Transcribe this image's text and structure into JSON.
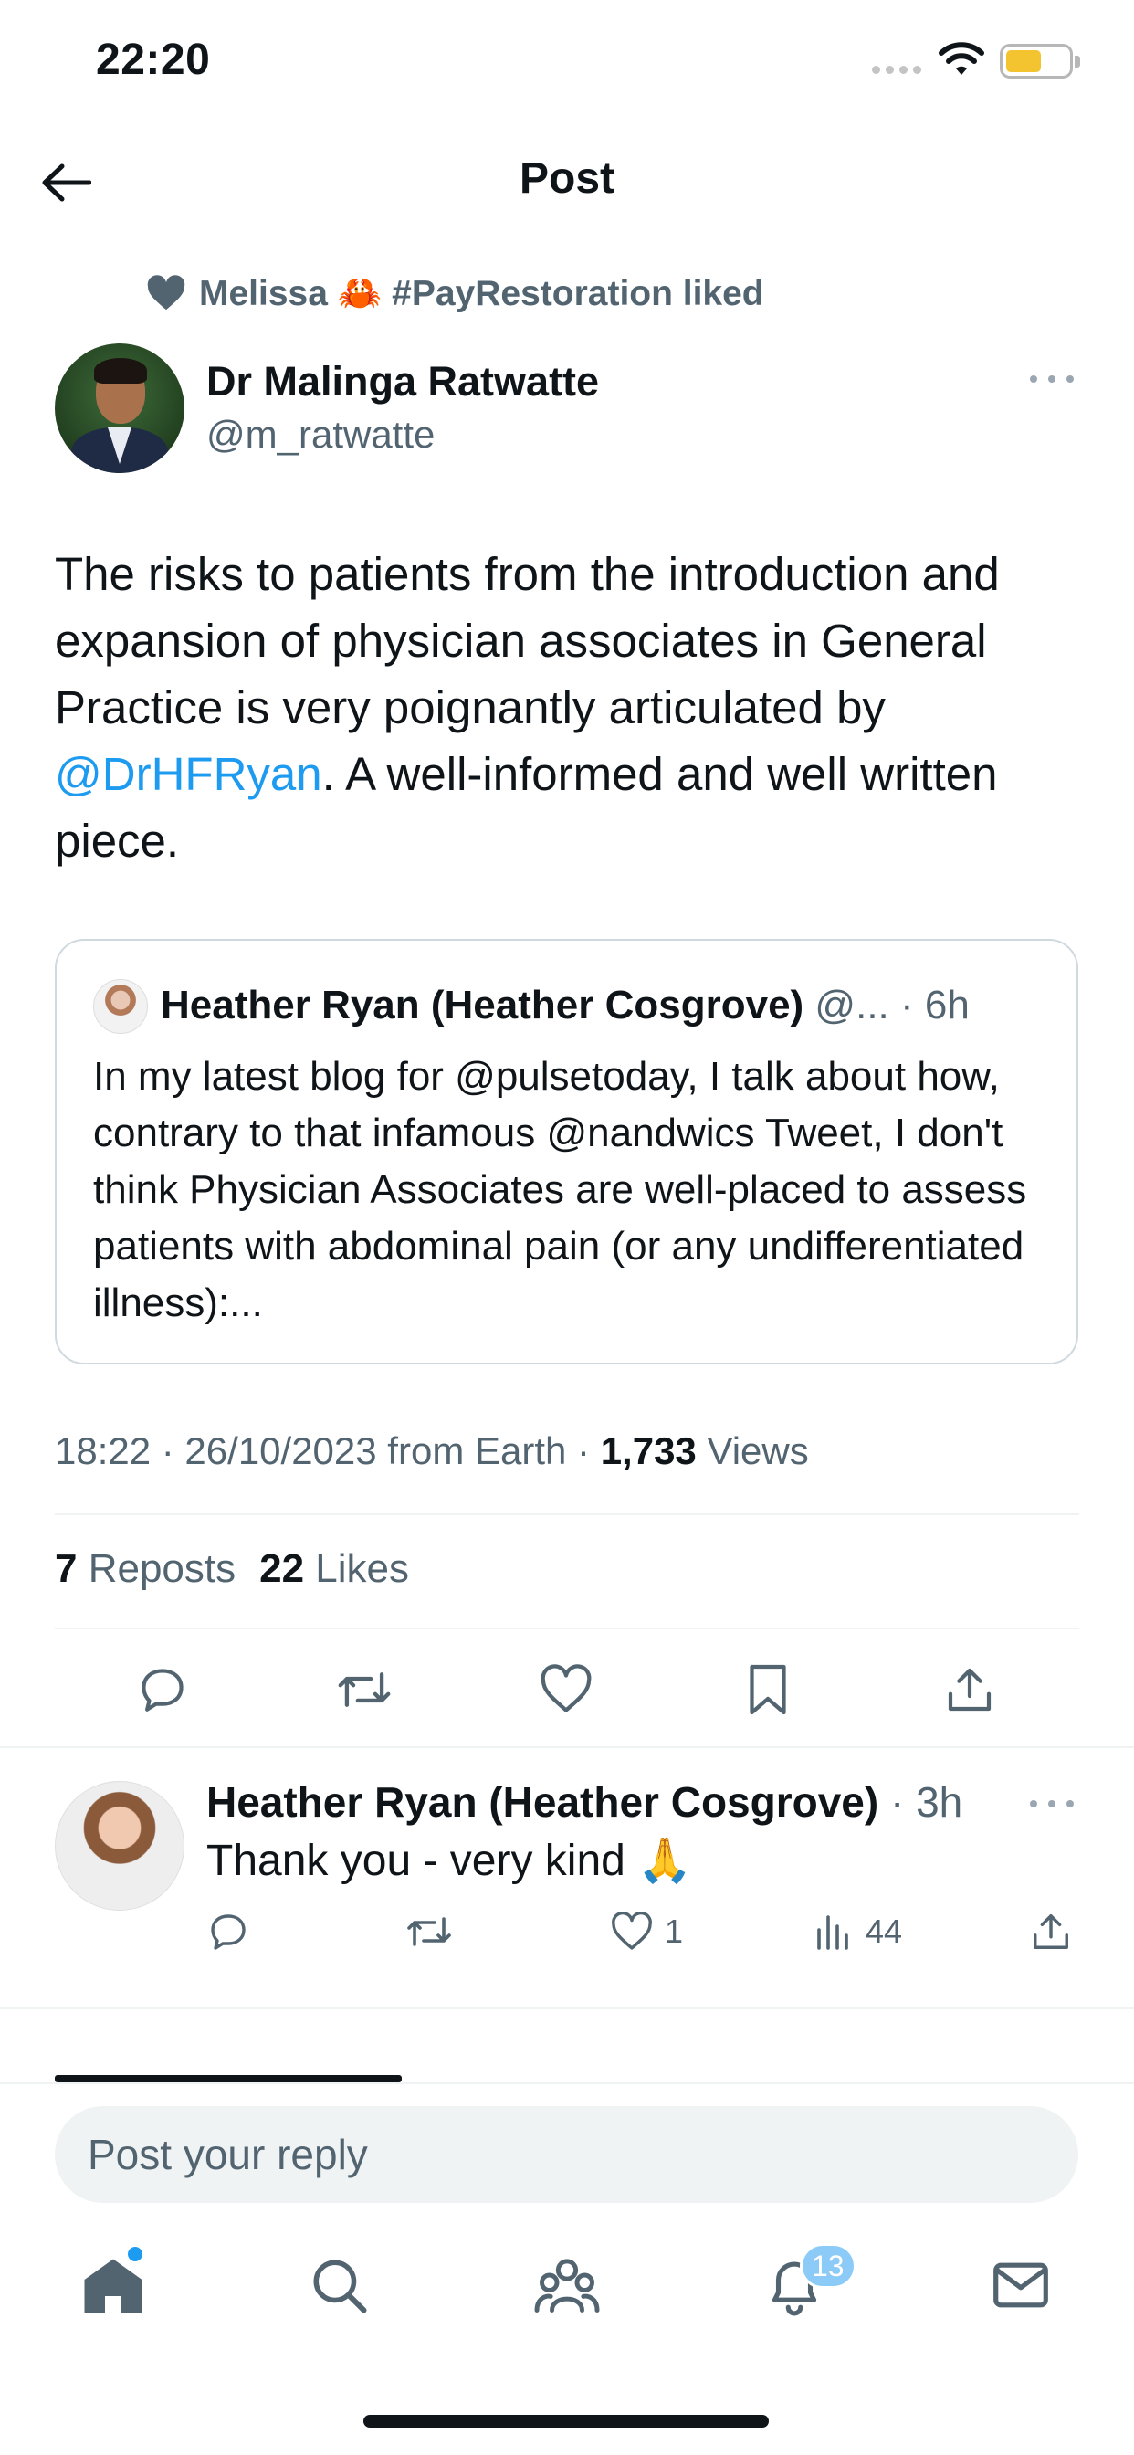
{
  "status_bar": {
    "time": "22:20"
  },
  "header": {
    "title": "Post"
  },
  "social_context": {
    "text": "Melissa 🦀 #PayRestoration liked"
  },
  "post": {
    "author_name": "Dr Malinga Ratwatte",
    "author_handle": "@m_ratwatte",
    "text_before_mention": "The risks to patients from the introduction and expansion of physician associates in General Practice is very poignantly articulated by ",
    "mention": "@DrHFRyan",
    "text_after_mention": ". A well-informed and well written piece.",
    "quote": {
      "author_name": "Heather Ryan (Heather Cosgrove)",
      "meta": " @... · 6h",
      "text": "In my latest blog for @pulsetoday, I talk about how, contrary to that infamous @nandwics Tweet, I don't think Physician Associates are well-placed to assess patients with abdominal pain (or any undifferentiated illness):..."
    },
    "timestamp": "18:22 · 26/10/2023 from Earth · ",
    "views_count": "1,733",
    "views_label": " Views",
    "reposts_count": "7",
    "reposts_label": " Reposts",
    "likes_count": "22",
    "likes_label": " Likes"
  },
  "reply": {
    "author_name": "Heather Ryan (Heather Cosgrove)",
    "meta": " · 3h",
    "text": "Thank you - very kind 🙏",
    "likes": "1",
    "views": "44"
  },
  "composer": {
    "placeholder": "Post your reply"
  },
  "tab_bar": {
    "notifications_badge": "13"
  },
  "colors": {
    "accent": "#1d9bf0",
    "text": "#0f1419",
    "secondary": "#536471",
    "border": "#cfd9de"
  },
  "icons": [
    "back-arrow-icon",
    "heart-icon",
    "more-icon",
    "reply-icon",
    "repost-icon",
    "like-icon",
    "bookmark-icon",
    "share-icon",
    "views-icon",
    "home-icon",
    "search-icon",
    "communities-icon",
    "notifications-icon",
    "messages-icon"
  ]
}
